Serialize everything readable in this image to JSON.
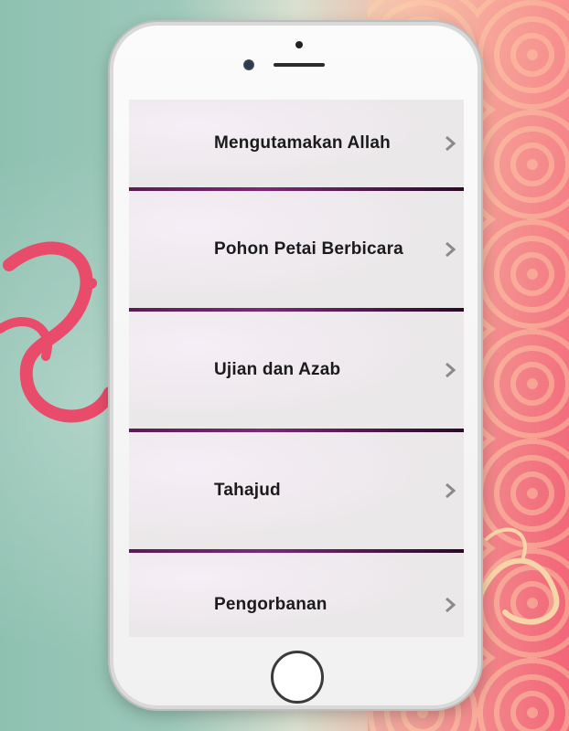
{
  "menu": {
    "items": [
      {
        "label": "Mengutamakan Allah"
      },
      {
        "label": "Pohon Petai Berbicara"
      },
      {
        "label": "Ujian dan Azab"
      },
      {
        "label": "Tahajud"
      },
      {
        "label": "Pengorbanan"
      }
    ]
  },
  "icons": {
    "chevron": "chevron-right-icon",
    "home": "home-button"
  },
  "colors": {
    "divider": "#5a1c55",
    "chevron": "#8a8a8a",
    "screen_bg": "#ebe8ea"
  }
}
